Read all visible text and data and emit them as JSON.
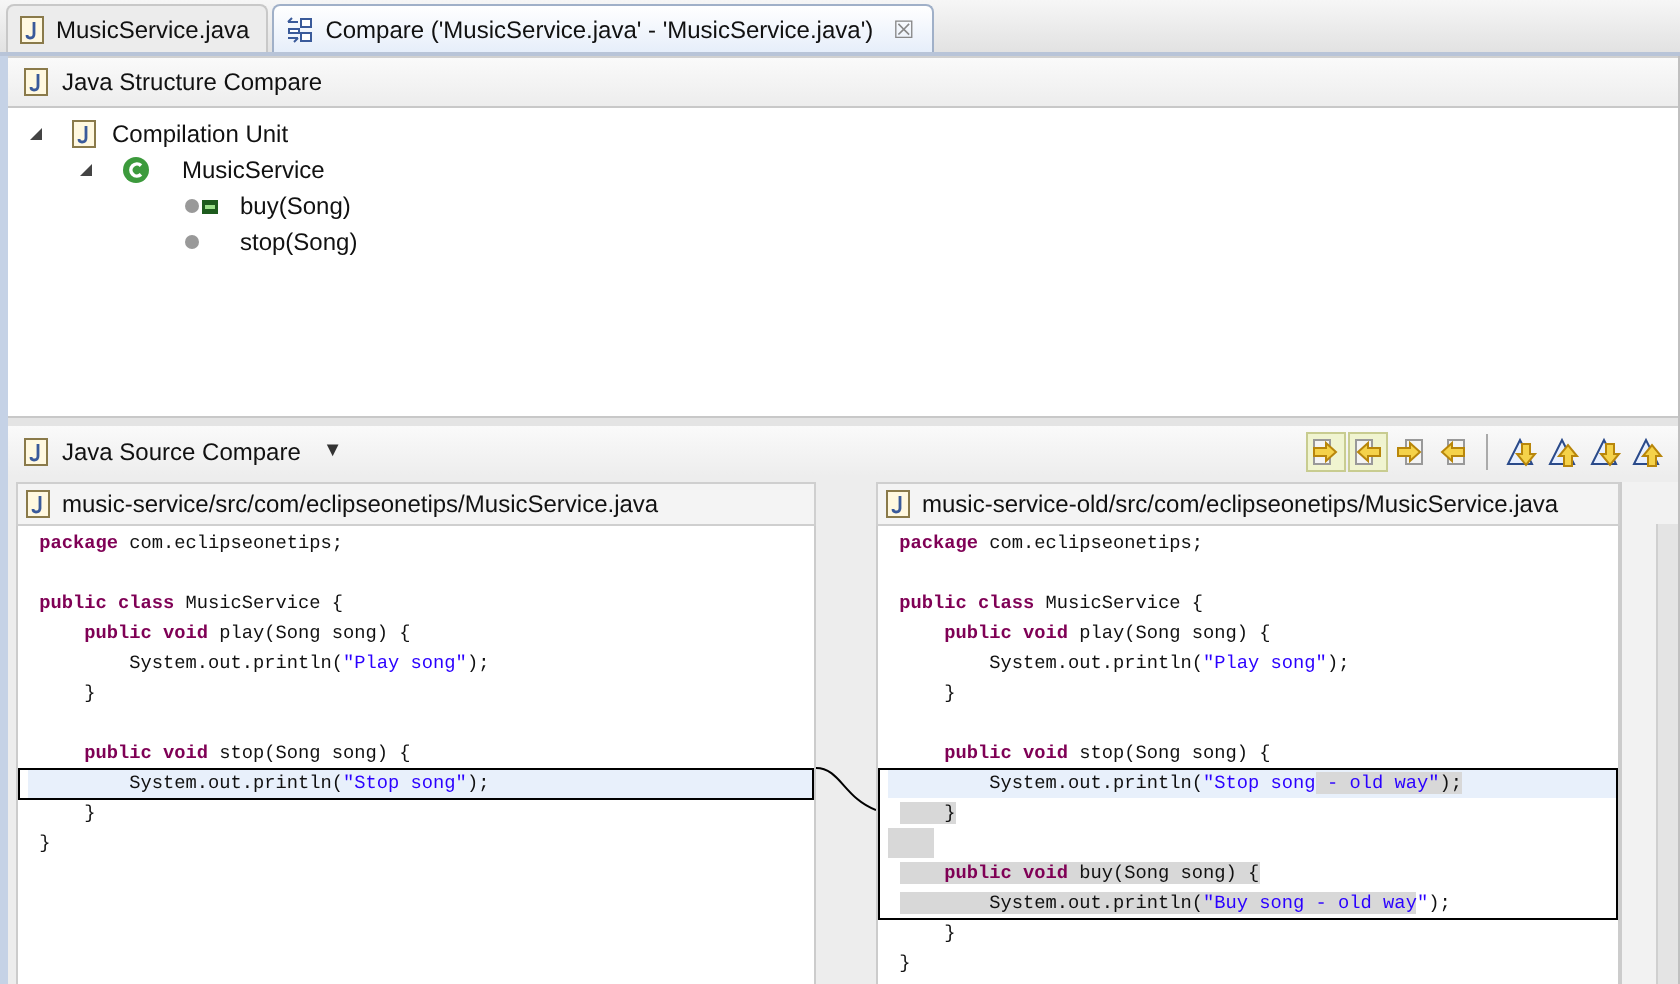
{
  "tabs": [
    {
      "label": "MusicService.java",
      "kind": "java",
      "selected": false
    },
    {
      "label": "Compare ('MusicService.java' - 'MusicService.java')",
      "kind": "compare",
      "selected": true,
      "close": "☒"
    }
  ],
  "structure": {
    "title": "Java Structure Compare",
    "tree": [
      {
        "label": "Compilation Unit",
        "kind": "unit",
        "expanded": true,
        "children": [
          {
            "label": "MusicService",
            "kind": "class",
            "expanded": true,
            "children": [
              {
                "label": "buy(Song)",
                "kind": "method",
                "added": true
              },
              {
                "label": "stop(Song)",
                "kind": "method",
                "added": false
              }
            ]
          }
        ]
      }
    ]
  },
  "source": {
    "title": "Java Source Compare",
    "menu": "▼",
    "left": {
      "path": "music-service/src/com/eclipseonetips/MusicService.java",
      "lines": [
        {
          "selected": false,
          "in_diff": false,
          "segments": [
            {
              "kind": "keyword",
              "text": "package"
            },
            {
              "kind": "plain",
              "text": " com.eclipseonetips;"
            }
          ]
        },
        {
          "selected": false,
          "in_diff": false
        },
        {
          "selected": false,
          "in_diff": false,
          "segments": [
            {
              "kind": "keyword",
              "text": "public class"
            },
            {
              "kind": "plain",
              "text": " MusicService {"
            }
          ]
        },
        {
          "selected": false,
          "in_diff": false,
          "segments": [
            {
              "kind": "keyword",
              "text": "    public void"
            },
            {
              "kind": "plain",
              "text": " play(Song song) {"
            }
          ]
        },
        {
          "selected": false,
          "in_diff": false,
          "segments": [
            {
              "kind": "plain",
              "text": "        System.out.println("
            },
            {
              "kind": "string",
              "text": "\"Play song\""
            },
            {
              "kind": "plain",
              "text": ");"
            }
          ]
        },
        {
          "selected": false,
          "in_diff": false,
          "segments": [
            {
              "kind": "plain",
              "text": "    }"
            }
          ]
        },
        {
          "selected": false,
          "in_diff": false
        },
        {
          "selected": false,
          "in_diff": false,
          "segments": [
            {
              "kind": "keyword",
              "text": "    public void"
            },
            {
              "kind": "plain",
              "text": " stop(Song song) {"
            }
          ]
        },
        {
          "selected": true,
          "in_diff": true,
          "segments": [
            {
              "kind": "plain",
              "text": "        System.out.println("
            },
            {
              "kind": "string",
              "text": "\"Stop song\""
            },
            {
              "kind": "plain",
              "text": ");"
            }
          ]
        },
        {
          "selected": false,
          "in_diff": false,
          "segments": [
            {
              "kind": "plain",
              "text": "    }"
            }
          ]
        },
        {
          "selected": false,
          "in_diff": false,
          "segments": [
            {
              "kind": "plain",
              "text": "}"
            }
          ]
        }
      ]
    },
    "right": {
      "path": "music-service-old/src/com/eclipseonetips/MusicService.java",
      "lines": [
        {
          "selected": false,
          "in_diff": false,
          "segments": [
            {
              "kind": "keyword",
              "text": "package",
              "changed": false
            },
            {
              "kind": "plain",
              "text": " com.eclipseonetips;",
              "changed": false
            }
          ]
        },
        {
          "selected": false,
          "in_diff": false
        },
        {
          "selected": false,
          "in_diff": false,
          "segments": [
            {
              "kind": "keyword",
              "text": "public class",
              "changed": false
            },
            {
              "kind": "plain",
              "text": " MusicService {",
              "changed": false
            }
          ]
        },
        {
          "selected": false,
          "in_diff": false,
          "segments": [
            {
              "kind": "keyword",
              "text": "    public void",
              "changed": false
            },
            {
              "kind": "plain",
              "text": " play(Song song) {",
              "changed": false
            }
          ]
        },
        {
          "selected": false,
          "in_diff": false,
          "segments": [
            {
              "kind": "plain",
              "text": "        System.out.println(",
              "changed": false
            },
            {
              "kind": "string",
              "text": "\"Play song\"",
              "changed": false
            },
            {
              "kind": "plain",
              "text": ");",
              "changed": false
            }
          ]
        },
        {
          "selected": false,
          "in_diff": false,
          "segments": [
            {
              "kind": "plain",
              "text": "    }",
              "changed": false
            }
          ]
        },
        {
          "selected": false,
          "in_diff": false
        },
        {
          "selected": false,
          "in_diff": false,
          "segments": [
            {
              "kind": "keyword",
              "text": "    public void",
              "changed": false
            },
            {
              "kind": "plain",
              "text": " stop(Song song) {",
              "changed": false
            }
          ]
        },
        {
          "selected": true,
          "in_diff": true,
          "segments": [
            {
              "kind": "plain",
              "text": "        System.out.println(",
              "changed": false
            },
            {
              "kind": "string",
              "text": "\"Stop song",
              "changed": false
            },
            {
              "kind": "string",
              "text": " - old way\"",
              "changed": true
            },
            {
              "kind": "plain",
              "text": ");",
              "changed": true
            }
          ]
        },
        {
          "selected": false,
          "in_diff": true,
          "segments": [
            {
              "kind": "plain",
              "text": "    }",
              "changed": true
            }
          ]
        },
        {
          "selected": false,
          "in_diff": true,
          "changed": true
        },
        {
          "selected": false,
          "in_diff": true,
          "segments": [
            {
              "kind": "keyword",
              "text": "    public void",
              "changed": true
            },
            {
              "kind": "plain",
              "text": " buy(Song song) {",
              "changed": true
            }
          ]
        },
        {
          "selected": false,
          "in_diff": true,
          "segments": [
            {
              "kind": "plain",
              "text": "        System.out.println(",
              "changed": true
            },
            {
              "kind": "string",
              "text": "\"Buy song - old way",
              "changed": true
            },
            {
              "kind": "string",
              "text": "\"",
              "changed": false
            },
            {
              "kind": "plain",
              "text": ");",
              "changed": false
            }
          ]
        },
        {
          "selected": false,
          "in_diff": false,
          "segments": [
            {
              "kind": "plain",
              "text": "    }",
              "changed": false
            }
          ]
        },
        {
          "selected": false,
          "in_diff": false,
          "segments": [
            {
              "kind": "plain",
              "text": "}",
              "changed": false
            }
          ]
        }
      ]
    }
  }
}
